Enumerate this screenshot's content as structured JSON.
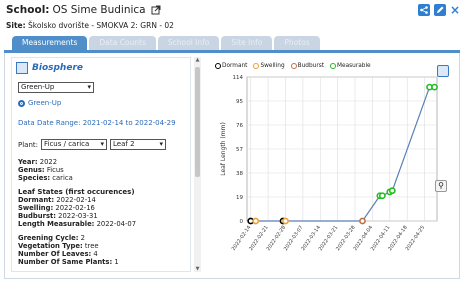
{
  "header": {
    "school_label": "School:",
    "school_name": "OS Sime Budinica",
    "site_label": "Site:",
    "site_name": "Školsko dvorište - SMOKVA 2: GRN - 02"
  },
  "tabs": [
    "Measurements",
    "Data Counts",
    "School Info",
    "Site Info",
    "Photos"
  ],
  "protocol": {
    "title": "Biosphere",
    "protocol_select": "Green-Up",
    "radio_label": "Green-Up",
    "date_range_label": "Data Date Range:",
    "date_range": "2021-02-14 to 2022-04-29",
    "plant_label": "Plant:",
    "plant_select": "Ficus / carica",
    "leaf_select": "Leaf 2"
  },
  "details": {
    "year_label": "Year:",
    "year": "2022",
    "genus_label": "Genus:",
    "genus": "Ficus",
    "species_label": "Species:",
    "species": "carica",
    "leaf_states_title": "Leaf States (first occurences)",
    "dormant_label": "Dormant:",
    "dormant": "2022-02-14",
    "swelling_label": "Swelling:",
    "swelling": "2022-02-16",
    "budburst_label": "Budburst:",
    "budburst": "2022-03-31",
    "length_label": "Length Measurable:",
    "length": "2022-04-07",
    "cycle_label": "Greening Cycle:",
    "cycle": "2",
    "veg_label": "Vegetation Type:",
    "veg": "tree",
    "leaves_label": "Number Of Leaves:",
    "leaves": "4",
    "plants_label": "Number Of Same Plants:",
    "plants": "1"
  },
  "legend": [
    "Dormant",
    "Swelling",
    "Budburst",
    "Measurable"
  ],
  "colors": {
    "accent": "#4f8ec8",
    "line": "#5b7fb8",
    "dormant": "#000000",
    "swelling": "#f0a030",
    "budburst": "#c07040",
    "measurable": "#22bb22"
  },
  "chart_data": {
    "type": "line",
    "ylabel": "Leaf Length (mm)",
    "y_ticks": [
      0,
      19,
      38,
      57,
      76,
      95,
      114
    ],
    "ylim": [
      0,
      114
    ],
    "x_ticks": [
      "2022-02-14",
      "2022-02-21",
      "2022-02-28",
      "2022-03-07",
      "2022-03-14",
      "2022-03-21",
      "2022-03-28",
      "2022-04-04",
      "2022-04-11",
      "2022-04-18",
      "2022-04-25"
    ],
    "grid": true,
    "points": [
      {
        "x": "2022-02-14",
        "y": 0,
        "state": "dormant"
      },
      {
        "x": "2022-02-16",
        "y": 0,
        "state": "swelling"
      },
      {
        "x": "2022-02-27",
        "y": 0,
        "state": "dormant"
      },
      {
        "x": "2022-02-28",
        "y": 0,
        "state": "swelling"
      },
      {
        "x": "2022-03-31",
        "y": 0,
        "state": "budburst"
      },
      {
        "x": "2022-04-07",
        "y": 20,
        "state": "measurable"
      },
      {
        "x": "2022-04-08",
        "y": 20,
        "state": "measurable"
      },
      {
        "x": "2022-04-11",
        "y": 23,
        "state": "measurable"
      },
      {
        "x": "2022-04-12",
        "y": 24,
        "state": "measurable"
      },
      {
        "x": "2022-04-27",
        "y": 106,
        "state": "measurable"
      },
      {
        "x": "2022-04-29",
        "y": 106,
        "state": "measurable"
      }
    ]
  }
}
